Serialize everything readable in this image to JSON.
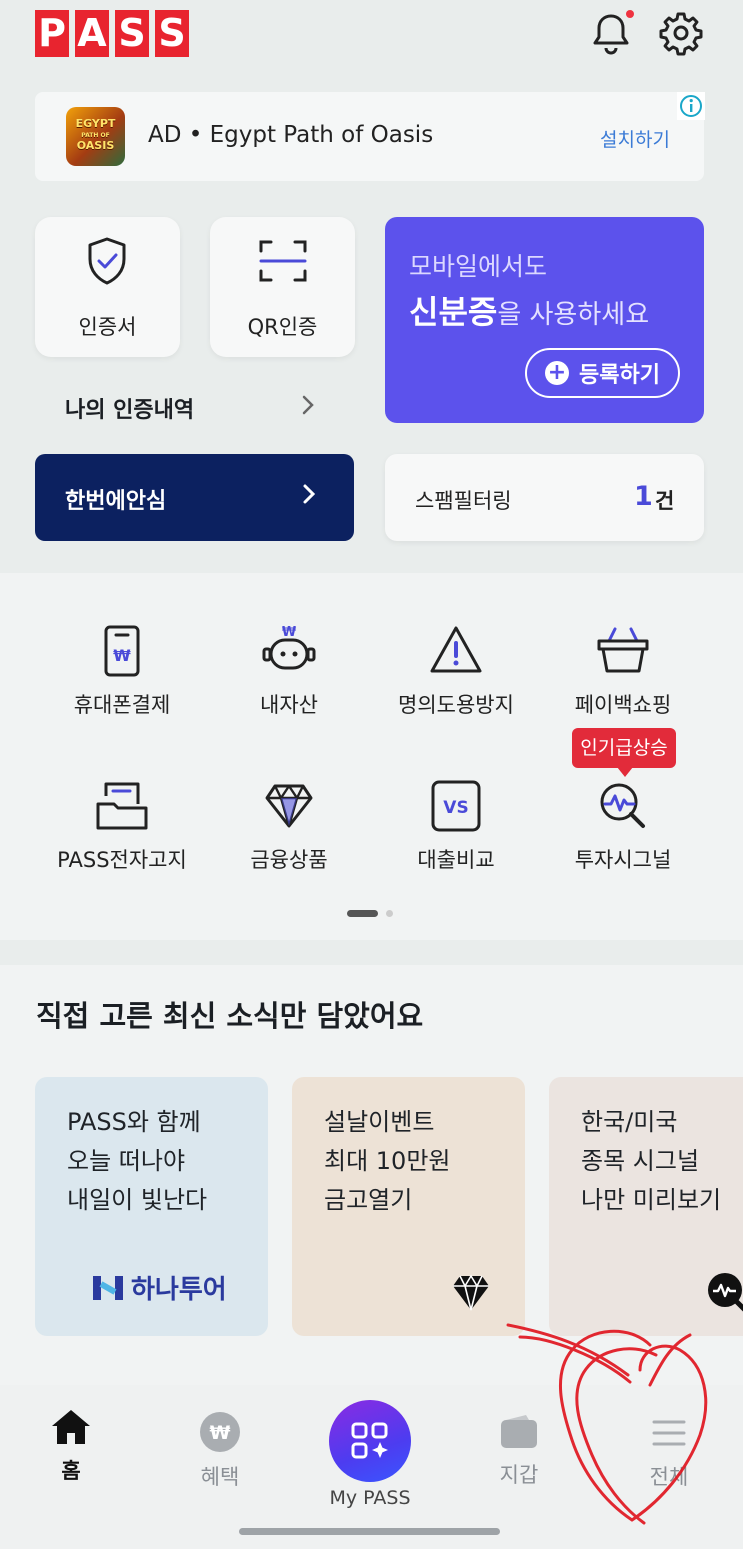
{
  "header": {
    "logo_letters": [
      "P",
      "A",
      "S",
      "S"
    ]
  },
  "ad": {
    "text": "AD • Egypt Path of Oasis",
    "install_label": "설치하기",
    "thumb_title": "EGYPT",
    "thumb_sub": "PATH OF",
    "thumb_title2": "OASIS"
  },
  "quick": {
    "cert_label": "인증서",
    "qr_label": "QR인증",
    "history_label": "나의 인증내역",
    "id_card": {
      "line1": "모바일에서도",
      "line2_bold": "신분증",
      "line2_rest": "을 사용하세요",
      "button_label": "등록하기"
    },
    "hanbeon_label": "한번에안심",
    "spam": {
      "label": "스팸필터링",
      "count": "1",
      "unit": "건"
    }
  },
  "menu": {
    "items": [
      {
        "label": "휴대폰결제",
        "icon": "phone-payment-icon"
      },
      {
        "label": "내자산",
        "icon": "robot-asset-icon"
      },
      {
        "label": "명의도용방지",
        "icon": "warning-icon"
      },
      {
        "label": "페이백쇼핑",
        "icon": "basket-icon"
      },
      {
        "label": "PASS전자고지",
        "icon": "e-notice-icon"
      },
      {
        "label": "금융상품",
        "icon": "diamond-icon"
      },
      {
        "label": "대출비교",
        "icon": "vs-icon"
      },
      {
        "label": "투자시그널",
        "icon": "signal-search-icon"
      }
    ],
    "badge": "인기급상승"
  },
  "news": {
    "title": "직접 고른 최신 소식만 담았어요",
    "cards": [
      {
        "lines": [
          "PASS와 함께",
          "오늘 떠나야",
          "내일이 빛난다"
        ],
        "brand": "하나투어",
        "bg": "#dbe7ee"
      },
      {
        "lines": [
          "설날이벤트",
          "최대 10만원",
          "금고열기"
        ],
        "bg": "#ede2d6"
      },
      {
        "lines": [
          "한국/미국",
          "종목 시그널",
          "나만 미리보기"
        ],
        "bg": "#ebe4e0"
      }
    ]
  },
  "bottom_nav": {
    "home": "홈",
    "benefits": "혜택",
    "mypass": "My PASS",
    "wallet": "지갑",
    "all": "전체"
  },
  "colors": {
    "brand_red": "#e8242f",
    "purple": "#5c52ec",
    "navy": "#0c2160"
  }
}
